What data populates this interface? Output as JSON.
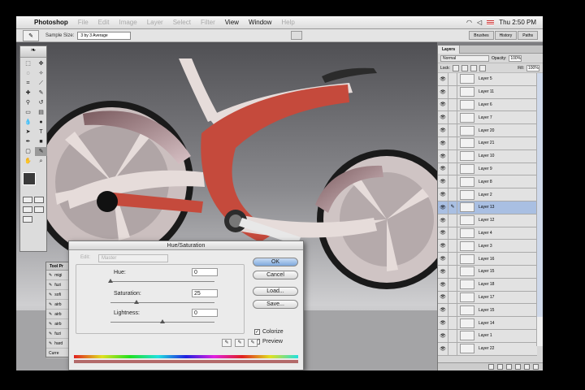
{
  "menubar": {
    "app_name": "Photoshop",
    "menus": [
      "File",
      "Edit",
      "Image",
      "Layer",
      "Select",
      "Filter",
      "View",
      "Window",
      "Help"
    ],
    "enabled": [
      "View",
      "Window"
    ],
    "clock": "Thu 2:50 PM"
  },
  "options_bar": {
    "sample_size_label": "Sample Size:",
    "sample_size_value": "3 by 3 Average",
    "palette_wells": [
      "Brushes",
      "History",
      "Paths"
    ]
  },
  "tool_presets": {
    "tab": "Tool Pr",
    "rows": [
      "migi",
      "fuzi",
      "sofi",
      "airb",
      "airb",
      "airb",
      "fuzi",
      "hard"
    ],
    "footer": "Curre"
  },
  "hue_saturation": {
    "title": "Hue/Saturation",
    "edit_label": "Edit:",
    "edit_value": "Master",
    "hue_label": "Hue:",
    "hue_value": "0",
    "saturation_label": "Saturation:",
    "saturation_value": "25",
    "lightness_label": "Lightness:",
    "lightness_value": "0",
    "ok_label": "OK",
    "cancel_label": "Cancel",
    "load_label": "Load...",
    "save_label": "Save...",
    "colorize_label": "Colorize",
    "preview_label": "Preview",
    "hue_level": 0.0,
    "saturation_level": 0.25,
    "lightness_level": 0.5
  },
  "layers": {
    "tabs": [
      "Layers"
    ],
    "blend_mode": "Normal",
    "opacity_label": "Opacity:",
    "opacity_value": "100%",
    "lock_label": "Lock:",
    "fill_label": "Fill:",
    "fill_value": "100%",
    "items": [
      {
        "name": "Layer 5",
        "selected": false
      },
      {
        "name": "Layer 11",
        "selected": false
      },
      {
        "name": "Layer 6",
        "selected": false
      },
      {
        "name": "Layer 7",
        "selected": false
      },
      {
        "name": "Layer 20",
        "selected": false
      },
      {
        "name": "Layer 21",
        "selected": false
      },
      {
        "name": "Layer 10",
        "selected": false
      },
      {
        "name": "Layer 9",
        "selected": false
      },
      {
        "name": "Layer 8",
        "selected": false
      },
      {
        "name": "Layer 2",
        "selected": false
      },
      {
        "name": "Layer 13",
        "selected": true
      },
      {
        "name": "Layer 12",
        "selected": false
      },
      {
        "name": "Layer 4",
        "selected": false
      },
      {
        "name": "Layer 3",
        "selected": false
      },
      {
        "name": "Layer 16",
        "selected": false
      },
      {
        "name": "Layer 15",
        "selected": false
      },
      {
        "name": "Layer 18",
        "selected": false
      },
      {
        "name": "Layer 17",
        "selected": false
      },
      {
        "name": "Layer 15",
        "selected": false
      },
      {
        "name": "Layer 14",
        "selected": false
      },
      {
        "name": "Layer 1",
        "selected": false
      },
      {
        "name": "Layer 22",
        "selected": false
      }
    ]
  },
  "colors": {
    "bike_red": "#c54a3c",
    "bike_body": "#e3d6d2",
    "canvas_bg": "#7d7d80",
    "selected_layer": "#a9bfe2"
  }
}
